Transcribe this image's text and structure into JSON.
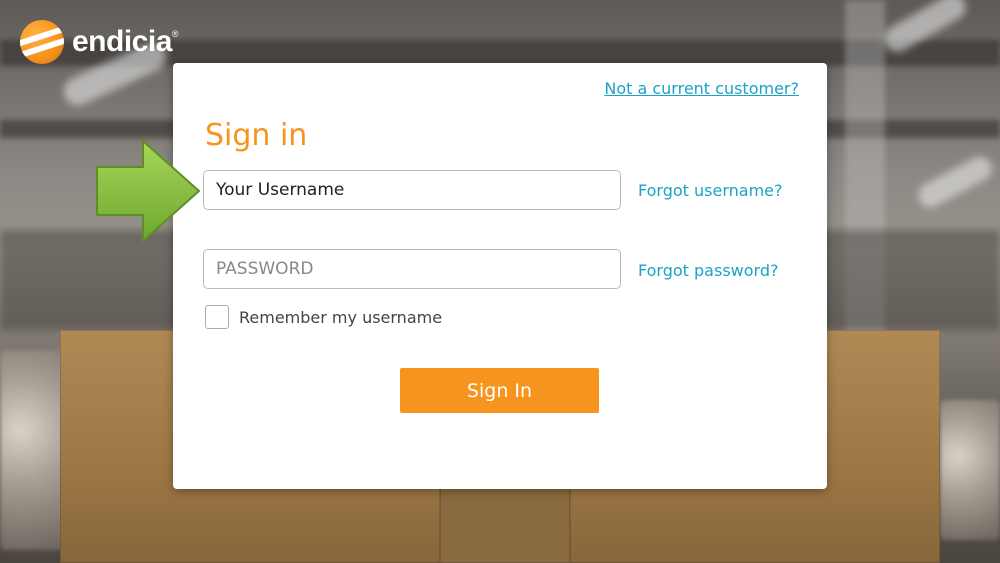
{
  "brand": {
    "name": "endicia",
    "trademark": "®"
  },
  "card": {
    "top_link": "Not a current customer?",
    "title": "Sign in",
    "username": {
      "value": "Your Username",
      "placeholder": "Your Username"
    },
    "password": {
      "value": "",
      "placeholder": "PASSWORD"
    },
    "forgot_username": "Forgot username?",
    "forgot_password": "Forgot password?",
    "remember_label": "Remember my username",
    "remember_checked": false,
    "submit_label": "Sign In"
  },
  "colors": {
    "accent": "#f7941d",
    "link": "#1aa3c7",
    "arrow": "#8dc63f"
  },
  "icons": {
    "logo": "endicia-globe-icon",
    "pointer": "green-arrow-icon"
  }
}
